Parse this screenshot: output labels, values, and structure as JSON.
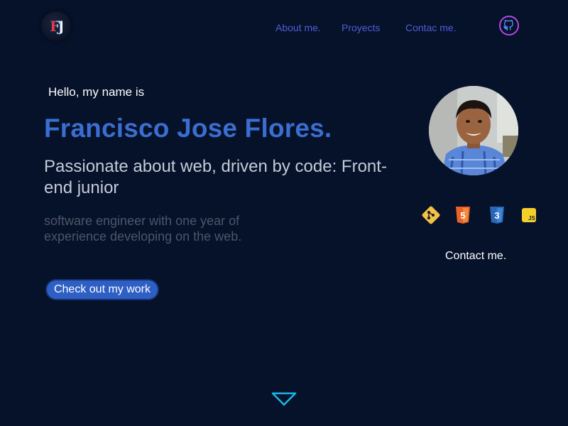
{
  "header": {
    "logo_text": "FJ",
    "nav": [
      {
        "label": "About me."
      },
      {
        "label": "Proyects"
      },
      {
        "label": "Contac me."
      }
    ],
    "github_icon": "github-icon"
  },
  "hero": {
    "greeting": "Hello, my name is",
    "name": "Francisco Jose Flores.",
    "tagline": "Passionate about web, driven by code: Front-end junior",
    "summary": "software engineer with one year of experience developing on the web.",
    "cta_label": "Check out my work"
  },
  "sidebar": {
    "avatar": "profile-photo",
    "skills": [
      "git-icon",
      "html5-icon",
      "css3-icon",
      "javascript-icon"
    ],
    "html5_glyph": "5",
    "css3_glyph": "3",
    "js_glyph": "JS",
    "contact_label": "Contact me."
  },
  "colors": {
    "background": "#06112a",
    "accent_blue": "#3a6ed0",
    "nav_link": "#4f5ed6",
    "github_ring": "#b04ae0",
    "scroll_arrow": "#19b8e6"
  }
}
